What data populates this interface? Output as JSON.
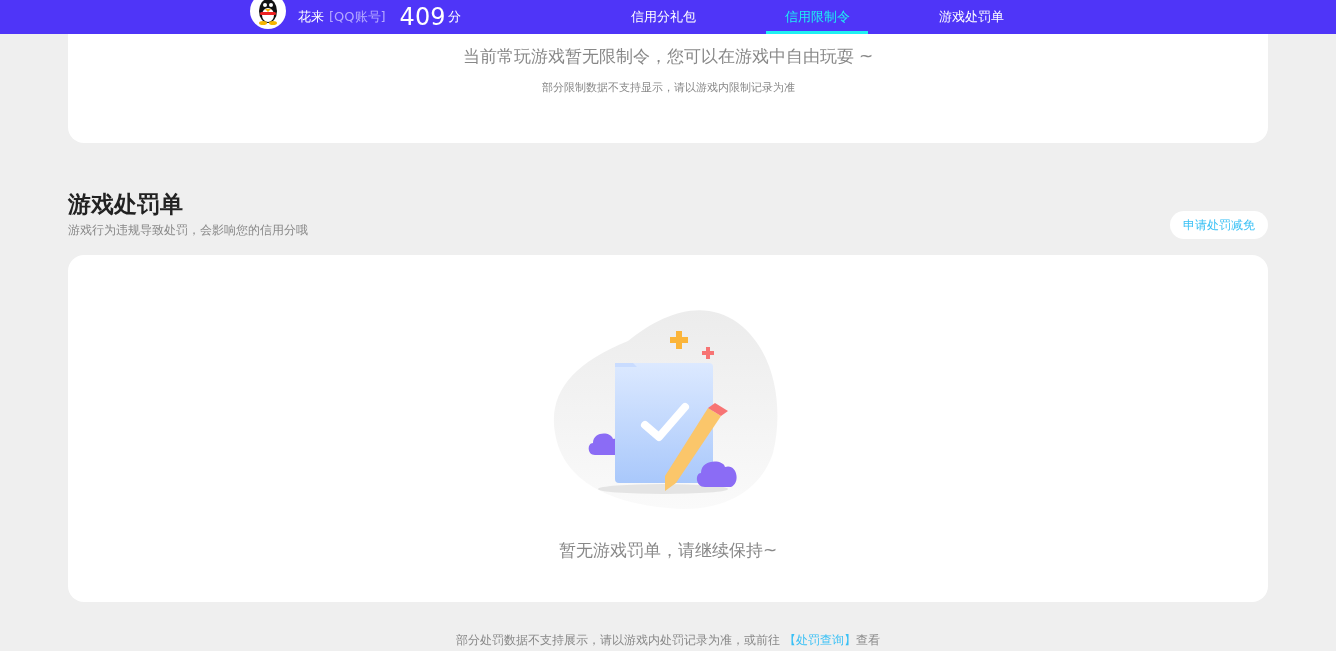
{
  "header": {
    "user": {
      "name": "花来",
      "account_label": "[QQ账号]",
      "score": "409",
      "score_unit": "分"
    },
    "tabs": [
      {
        "label": "信用分礼包",
        "selected": false
      },
      {
        "label": "信用限制令",
        "selected": true
      },
      {
        "label": "游戏处罚单",
        "selected": false
      }
    ]
  },
  "restriction_card": {
    "message": "当前常玩游戏暂无限制令，您可以在游戏中自由玩耍 ~",
    "note": "部分限制数据不支持显示，请以游戏内限制记录为准"
  },
  "penalty_section": {
    "title": "游戏处罚单",
    "subtitle": "游戏行为违规导致处罚，会影响您的信用分哦",
    "appeal_button": "申请处罚减免",
    "empty_message": "暂无游戏罚单，请继续保持~"
  },
  "footer": {
    "text": "部分处罚数据不支持展示，请以游戏内处罚记录为准，或前往 ",
    "link": "【处罚查询】",
    "suffix": "查看"
  }
}
